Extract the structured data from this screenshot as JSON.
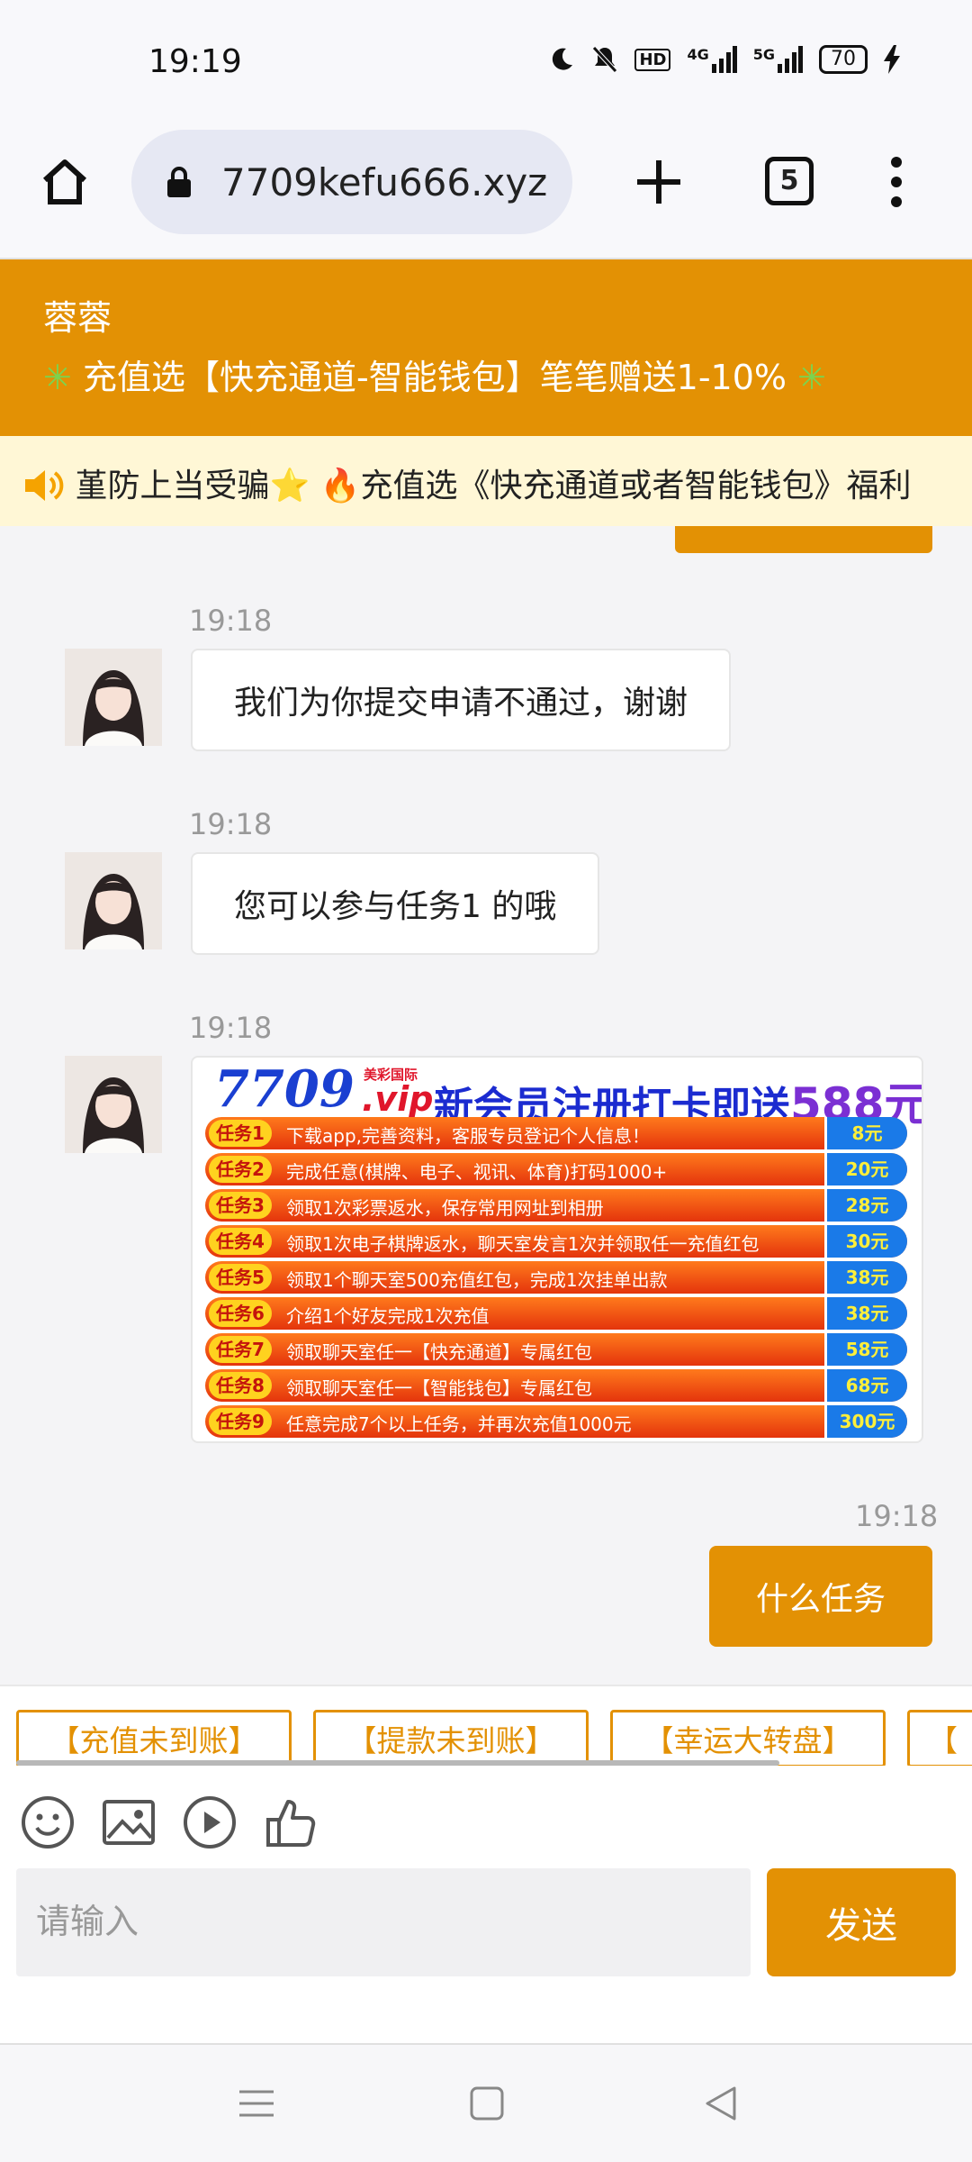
{
  "status_bar": {
    "time": "19:19",
    "signal_labels": [
      "HD",
      "4G",
      "5G"
    ],
    "battery": "70"
  },
  "browser": {
    "url": "7709kefu666.xyz",
    "tab_count": "5"
  },
  "header": {
    "agent_name": "蓉蓉",
    "notice": "充值选【快充通道-智能钱包】笔笔赠送1-10%"
  },
  "marquee": {
    "text": "堇防上当受骗⭐ 🔥充值选《快充通道或者智能钱包》福利"
  },
  "messages": [
    {
      "time": "19:18",
      "text": "我们为你提交申请不通过，谢谢"
    },
    {
      "time": "19:18",
      "text": "您可以参与任务1 的哦"
    },
    {
      "time": "19:18"
    },
    {
      "time": "19:18",
      "text": "什么任务"
    }
  ],
  "promo": {
    "number": "7709",
    "brand": "美彩国际",
    "vip": ".vip",
    "title_prefix": "新会员注册打卡即送",
    "title_amount": "588元",
    "tasks": [
      {
        "tag": "任务1",
        "desc": "下载app,完善资料，客服专员登记个人信息！",
        "reward": "8元"
      },
      {
        "tag": "任务2",
        "desc": "完成任意(棋牌、电子、视讯、体育)打码1000+",
        "reward": "20元"
      },
      {
        "tag": "任务3",
        "desc": "领取1次彩票返水，保存常用网址到相册",
        "reward": "28元"
      },
      {
        "tag": "任务4",
        "desc": "领取1次电子棋牌返水，聊天室发言1次并领取任一充值红包",
        "reward": "30元"
      },
      {
        "tag": "任务5",
        "desc": "领取1个聊天室500充值红包，完成1次挂单出款",
        "reward": "38元"
      },
      {
        "tag": "任务6",
        "desc": "介绍1个好友完成1次充值",
        "reward": "38元"
      },
      {
        "tag": "任务7",
        "desc": "领取聊天室任一【快充通道】专属红包",
        "reward": "58元"
      },
      {
        "tag": "任务8",
        "desc": "领取聊天室任一【智能钱包】专属红包",
        "reward": "68元"
      },
      {
        "tag": "任务9",
        "desc": "任意完成7个以上任务，并再次充值1000元",
        "reward": "300元"
      }
    ]
  },
  "quick_tags": [
    "【充值未到账】",
    "【提款未到账】",
    "【幸运大转盘】",
    "【"
  ],
  "input": {
    "placeholder": "请输入",
    "send_label": "发送"
  },
  "colors": {
    "accent": "#e39104",
    "marquee_bg": "#fff7d6",
    "page_bg": "#f4f4f6"
  },
  "icons": [
    "home-icon",
    "lock-icon",
    "plus-icon",
    "tabs-icon",
    "more-vert-icon",
    "speaker-icon",
    "emoji-icon",
    "image-icon",
    "play-icon",
    "thumbs-up-icon",
    "nav-menu-icon",
    "nav-home-icon",
    "nav-back-icon"
  ]
}
